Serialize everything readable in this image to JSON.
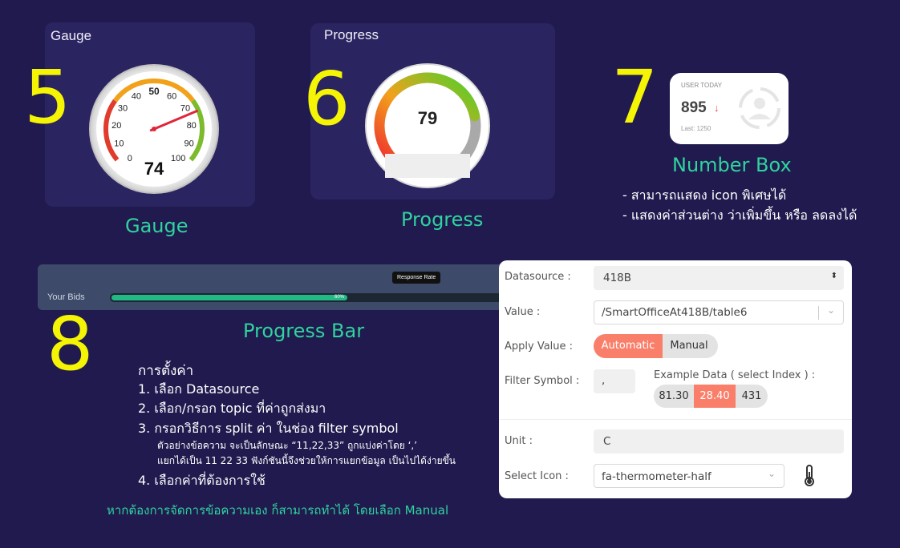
{
  "gauge": {
    "card_title": "Gauge",
    "number": "5",
    "caption": "Gauge",
    "value": 74,
    "value_label": "74",
    "ticks": [
      "0",
      "10",
      "20",
      "30",
      "40",
      "50",
      "60",
      "70",
      "80",
      "90",
      "100"
    ]
  },
  "progress": {
    "card_title": "Progress",
    "number": "6",
    "caption": "Progress",
    "value": 79,
    "value_label": "79"
  },
  "number_box": {
    "number": "7",
    "caption": "Number Box",
    "title": "USER TODAY",
    "value": "895",
    "last": "Last: 1250",
    "notes": [
      "- สามารถแสดง icon พิเศษได้",
      "- แสดงค่าส่วนต่าง ว่าเพิ่มขึ้น หรือ ลดลงได้"
    ]
  },
  "progress_bar": {
    "number": "8",
    "caption": "Progress Bar",
    "row_label": "Your Bids",
    "tooltip": "Response Rate",
    "value": 0.6,
    "value_label": "60%"
  },
  "instructions": {
    "heading": "การตั้งค่า",
    "step1": "1. เลือก Datasource",
    "step2": "2. เลือก/กรอก topic ที่ค่าถูกส่งมา",
    "step3": "3. กรอกวิธีการ split ค่า ในช่อง filter symbol",
    "step3_sub1": "ตัวอย่างข้อความ จะเป็นลักษณะ “11,22,33” ถูกแบ่งค่าโดย ‘,’",
    "step3_sub2": "แยกได้เป็น 11 22 33 ฟังก์ชันนี้จึงช่วยให้การแยกข้อมูล เป็นไปได้ง่ายขึ้น",
    "step4": "4. เลือกค่าที่ต้องการใช้",
    "footer": "หากต้องการจัดการข้อความเอง ก็สามารถทำได้ โดยเลือก Manual"
  },
  "panel": {
    "datasource_label": "Datasource :",
    "datasource_value": "418B",
    "value_label": "Value :",
    "value_value": "/SmartOfficeAt418B/table6",
    "apply_label": "Apply Value :",
    "apply_automatic": "Automatic",
    "apply_manual": "Manual",
    "filter_label": "Filter Symbol :",
    "filter_value": ",",
    "example_label": "Example Data ( select Index ) :",
    "example_items": [
      "81.30",
      "28.40",
      "431"
    ],
    "example_selected": 1,
    "unit_label": "Unit :",
    "unit_value": "C",
    "icon_label": "Select Icon :",
    "icon_value": "fa-thermometer-half"
  },
  "colors": {
    "background": "#211a4f",
    "highlight": "#f4f404",
    "caption": "#2fd39e",
    "accent": "#fa7f6a"
  }
}
